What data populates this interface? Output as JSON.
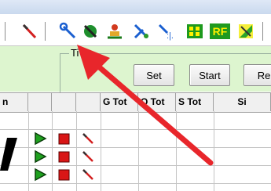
{
  "toolbar": {
    "icons": [
      "red-wrench-icon",
      "wrench-icon",
      "green-wrench-icon",
      "red-person-icon",
      "tool-cross-icon",
      "tool-bracket-icon",
      "green-grid-icon",
      "rf-icon",
      "green-arrow-icon"
    ],
    "rf_label": "RF"
  },
  "group": {
    "title": "Ti",
    "buttons": {
      "set": "Set",
      "start": "Start",
      "reset": "Re"
    }
  },
  "table": {
    "columns": [
      "n",
      "",
      "",
      "",
      "G Tot",
      "Q Tot",
      "S Tot",
      "Si"
    ],
    "rows": [
      {
        "play": "play-icon",
        "stop": "stop-icon",
        "edit": "pen-icon"
      },
      {
        "play": "play-icon",
        "stop": "stop-icon",
        "edit": "pen-icon"
      },
      {
        "play": "play-icon",
        "stop": "stop-icon",
        "edit": "pen-icon"
      }
    ]
  },
  "annotation": {
    "color": "#e8262b"
  },
  "colors": {
    "panel": "#ddf5cf",
    "play": "#1fa11f",
    "stop": "#d91616"
  }
}
